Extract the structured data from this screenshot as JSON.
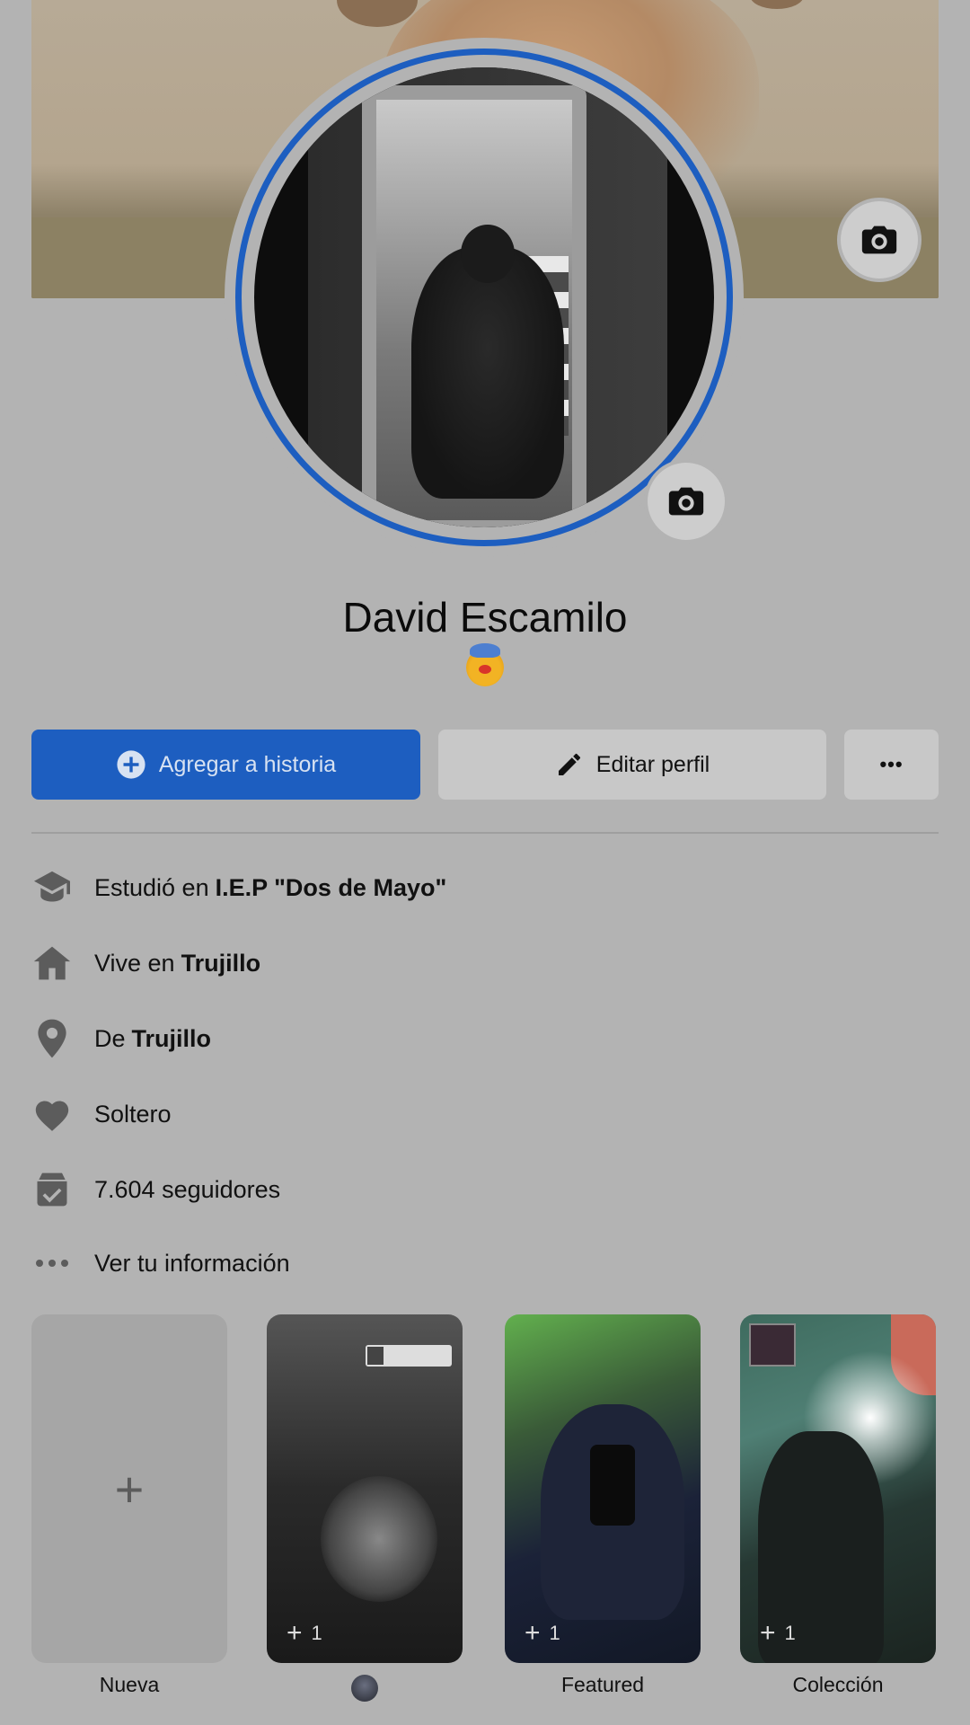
{
  "profile": {
    "name": "David Escamilo",
    "status_emoji": "clown-face"
  },
  "actions": {
    "add_story": "Agregar a historia",
    "edit_profile": "Editar perfil",
    "more": "•••"
  },
  "intro": [
    {
      "icon": "graduation-cap-icon",
      "prefix": "Estudió en",
      "value": "I.E.P \"Dos de Mayo\""
    },
    {
      "icon": "home-icon",
      "prefix": "Vive en",
      "value": "Trujillo"
    },
    {
      "icon": "location-pin-icon",
      "prefix": "De",
      "value": "Trujillo"
    },
    {
      "icon": "heart-icon",
      "prefix": "Soltero",
      "value": ""
    },
    {
      "icon": "followers-icon",
      "prefix": "7.604 seguidores",
      "value": ""
    },
    {
      "icon": "ellipsis-icon",
      "prefix": "Ver tu información",
      "value": ""
    }
  ],
  "featured": {
    "new_label": "Nueva",
    "new_plus": "+",
    "items": [
      {
        "label": "",
        "count": "1"
      },
      {
        "label": "Featured",
        "count": "1"
      },
      {
        "label": "Colección",
        "count": "1"
      }
    ]
  },
  "colors": {
    "primary": "#1d5ec0",
    "background": "#b3b3b3"
  }
}
